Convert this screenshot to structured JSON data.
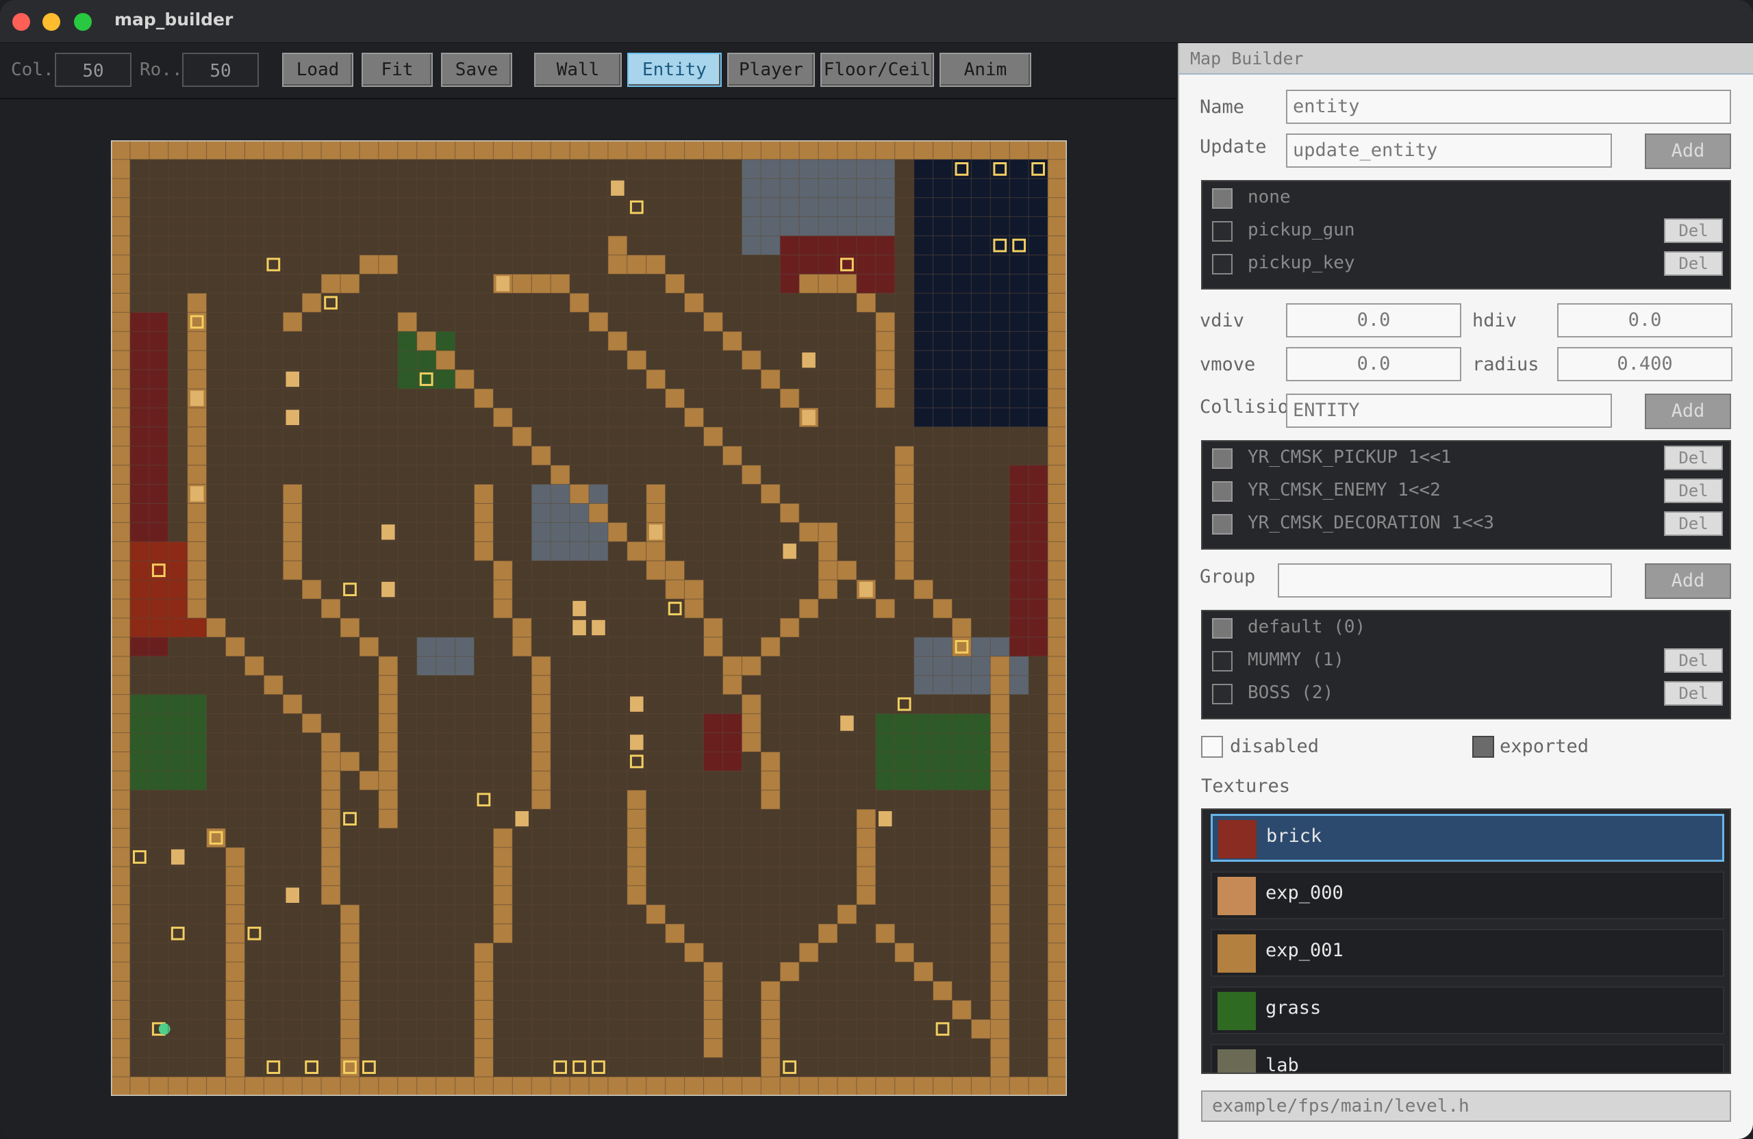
{
  "window": {
    "title": "map_builder"
  },
  "toolbar": {
    "col_label": "Col...",
    "col_value": "50",
    "row_label": "Ro...",
    "row_value": "50",
    "load": "Load",
    "fit": "Fit",
    "save": "Save",
    "modes": [
      "Wall",
      "Entity",
      "Player",
      "Floor/Ceil",
      "Anim"
    ],
    "active_mode": "Entity"
  },
  "panel": {
    "title": "Map Builder",
    "name_label": "Name",
    "name_value": "entity",
    "update_label": "Update",
    "update_value": "update_entity",
    "add": "Add",
    "update_list": [
      {
        "label": "none",
        "checked": true,
        "deletable": false
      },
      {
        "label": "pickup_gun",
        "checked": false,
        "deletable": true
      },
      {
        "label": "pickup_key",
        "checked": false,
        "deletable": true
      }
    ],
    "del": "Del",
    "vdiv_label": "vdiv",
    "vdiv_value": "0.0",
    "hdiv_label": "hdiv",
    "hdiv_value": "0.0",
    "vmove_label": "vmove",
    "vmove_value": "0.0",
    "radius_label": "radius",
    "radius_value": "0.400",
    "collision_label": "Collisio...",
    "collision_value": "ENTITY",
    "collision_list": [
      {
        "label": "YR_CMSK_PICKUP   1<<1",
        "checked": true
      },
      {
        "label": "YR_CMSK_ENEMY   1<<2",
        "checked": true
      },
      {
        "label": "YR_CMSK_DECORATION   1<<3",
        "checked": true
      }
    ],
    "group_label": "Group",
    "group_value": "",
    "group_list": [
      {
        "label": "default (0)",
        "checked": true,
        "deletable": false
      },
      {
        "label": "MUMMY (1)",
        "checked": false,
        "deletable": true
      },
      {
        "label": "BOSS (2)",
        "checked": false,
        "deletable": true
      }
    ],
    "disabled_label": "disabled",
    "disabled_checked": false,
    "exported_label": "exported",
    "exported_checked": true,
    "textures_label": "Textures",
    "textures": [
      {
        "name": "brick",
        "selected": true,
        "thumb_color": "#8a2c22"
      },
      {
        "name": "exp_000",
        "selected": false,
        "thumb_color": "#c58a55"
      },
      {
        "name": "exp_001",
        "selected": false,
        "thumb_color": "#b3803f"
      },
      {
        "name": "grass",
        "selected": false,
        "thumb_color": "#2f6a22"
      },
      {
        "name": "lab",
        "selected": false,
        "thumb_color": "#6b6a55"
      }
    ],
    "status_path": "example/fps/main/level.h"
  },
  "map": {
    "cols": 50,
    "rows": 50,
    "colors": {
      "floor": "#4b3b2b",
      "wall": "#b17f3f",
      "door": "#e0b36a",
      "red": "#6a1f1f",
      "stone": "#5d6670",
      "green": "#2e5a28",
      "space": "#10182c",
      "lava": "#8c2a16",
      "entity": "#f3cf60",
      "player": "#4ecf8a",
      "grid": "#5a4836"
    }
  }
}
